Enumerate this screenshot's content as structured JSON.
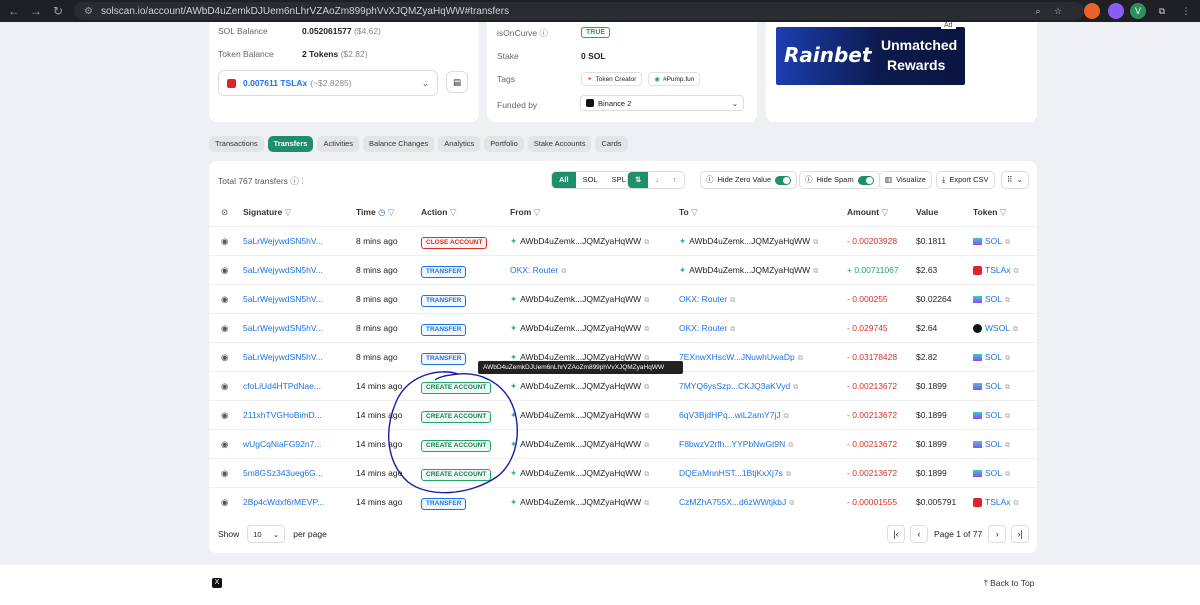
{
  "browser": {
    "url": "solscan.io/account/AWbD4uZemkDJUem6nLhrVZAoZm899phVvXJQMZyaHqWW#transfers",
    "back": "←",
    "forward": "→",
    "reload": "↻",
    "tune": "⚙"
  },
  "overview": {
    "sol_balance_label": "SOL Balance",
    "sol_balance_value": "0.052061577",
    "sol_balance_usd": "($4.62)",
    "token_balance_label": "Token Balance",
    "token_balance_value": "2 Tokens",
    "token_balance_usd": "($2.82)",
    "token_select_amount": "0.007611 TSLAx",
    "token_select_usd": "(~$2.8285)"
  },
  "more_info": {
    "is_on_curve_label": "isOnCurve",
    "is_on_curve_value": "TRUE",
    "stake_label": "Stake",
    "stake_value": "0 SOL",
    "tags_label": "Tags",
    "tags": [
      "Token Creator",
      "#Pump.fun"
    ],
    "funded_by_label": "Funded by",
    "funded_by_value": "Binance 2"
  },
  "ad": {
    "badge": "Ad",
    "brand": "Rainbet",
    "headline1": "Unmatched",
    "headline2": "Rewards",
    "colors": {
      "bg": "#0d1a4d",
      "accent": "#3b6bff"
    }
  },
  "tabs": [
    "Transactions",
    "Transfers",
    "Activities",
    "Balance Changes",
    "Analytics",
    "Portfolio",
    "Stake Accounts",
    "Cards"
  ],
  "active_tab": "Transfers",
  "toolbar": {
    "total_text": "Total 767 transfers",
    "filters": [
      "All",
      "SOL",
      "SPL"
    ],
    "hide_zero_label": "Hide Zero Value",
    "hide_spam_label": "Hide Spam",
    "visualize_label": "Visualize",
    "export_label": "Export CSV"
  },
  "columns": [
    "Signature",
    "Time",
    "Action",
    "From",
    "To",
    "Amount",
    "Value",
    "Token"
  ],
  "rows": [
    {
      "sig": "5aLrWejywdSN5hV...",
      "time": "8 mins ago",
      "action": "CLOSE ACCOUNT",
      "kind": "close",
      "from": "AWbD4uZemk...JQMZyaHqWW",
      "from_star": true,
      "to": "AWbD4uZemk...JQMZyaHqWW",
      "to_star": true,
      "amount": "- 0.00203928",
      "sign": "neg",
      "value": "$0.1811",
      "token": "SOL",
      "tok": "sol"
    },
    {
      "sig": "5aLrWejywdSN5hV...",
      "time": "8 mins ago",
      "action": "TRANSFER",
      "kind": "transfer",
      "from": "OKX: Router",
      "from_star": false,
      "to": "AWbD4uZemk...JQMZyaHqWW",
      "to_star": true,
      "amount": "+ 0.00711067",
      "sign": "pos",
      "value": "$2.63",
      "token": "TSLAx",
      "tok": "tsla"
    },
    {
      "sig": "5aLrWejywdSN5hV...",
      "time": "8 mins ago",
      "action": "TRANSFER",
      "kind": "transfer",
      "from": "AWbD4uZemk...JQMZyaHqWW",
      "from_star": true,
      "to": "OKX: Router",
      "to_star": false,
      "amount": "- 0.000255",
      "sign": "neg",
      "value": "$0.02264",
      "token": "SOL",
      "tok": "sol"
    },
    {
      "sig": "5aLrWejywdSN5hV...",
      "time": "8 mins ago",
      "action": "TRANSFER",
      "kind": "transfer",
      "from": "AWbD4uZemk...JQMZyaHqWW",
      "from_star": true,
      "to": "OKX: Router",
      "to_star": false,
      "amount": "- 0.029745",
      "sign": "neg",
      "value": "$2.64",
      "token": "WSOL",
      "tok": "wsol"
    },
    {
      "sig": "5aLrWejywdSN5hV...",
      "time": "8 mins ago",
      "action": "TRANSFER",
      "kind": "transfer",
      "from": "AWbD4uZemk...JQMZyaHqWW",
      "from_star": true,
      "to": "7EXnwXHscW...JNuwhUwaDp",
      "to_star": false,
      "amount": "- 0.03178428",
      "sign": "neg",
      "value": "$2.82",
      "token": "SOL",
      "tok": "sol"
    },
    {
      "sig": "cfoLiUd4HTPdNae...",
      "time": "14 mins ago",
      "action": "CREATE ACCOUNT",
      "kind": "create",
      "from": "AWbD4uZemk...JQMZyaHqWW",
      "from_star": true,
      "to": "7MYQ6ysSzp...CKJQ3aKVyd",
      "to_star": false,
      "amount": "- 0.00213672",
      "sign": "neg",
      "value": "$0.1899",
      "token": "SOL",
      "tok": "sol"
    },
    {
      "sig": "211xhTVGHoBimD...",
      "time": "14 mins ago",
      "action": "CREATE ACCOUNT",
      "kind": "create",
      "from": "AWbD4uZemk...JQMZyaHqWW",
      "from_star": true,
      "to": "6qV3BjdHPq...wiL2amY7jJ",
      "to_star": false,
      "amount": "- 0.00213672",
      "sign": "neg",
      "value": "$0.1899",
      "token": "SOL",
      "tok": "sol"
    },
    {
      "sig": "wUgCqNiaFG92n7...",
      "time": "14 mins ago",
      "action": "CREATE ACCOUNT",
      "kind": "create",
      "from": "AWbD4uZemk...JQMZyaHqWW",
      "from_star": true,
      "to": "F8bwzV2rfh...YYPbNwGt9N",
      "to_star": false,
      "amount": "- 0.00213672",
      "sign": "neg",
      "value": "$0.1899",
      "token": "SOL",
      "tok": "sol"
    },
    {
      "sig": "5m8GSz343ueg6G...",
      "time": "14 mins ago",
      "action": "CREATE ACCOUNT",
      "kind": "create",
      "from": "AWbD4uZemk...JQMZyaHqWW",
      "from_star": true,
      "to": "DQEaMnnHST...1BtjKxXj7s",
      "to_star": false,
      "amount": "- 0.00213672",
      "sign": "neg",
      "value": "$0.1899",
      "token": "SOL",
      "tok": "sol"
    },
    {
      "sig": "2Bp4cWdxf6rMEVP...",
      "time": "14 mins ago",
      "action": "TRANSFER",
      "kind": "transfer",
      "from": "AWbD4uZemk...JQMZyaHqWW",
      "from_star": true,
      "to": "CzMZhA755X...d6zWWtjkbJ",
      "to_star": false,
      "amount": "- 0.00001555",
      "sign": "neg",
      "value": "$0.005791",
      "token": "TSLAx",
      "tok": "tsla"
    }
  ],
  "tooltip": "AWbD4uZemkDJUem6nLhrVZAoZm899phVvXJQMZyaHqWW",
  "pagination": {
    "show_label": "Show",
    "page_size": "10",
    "per_page_label": "per page",
    "page_text": "Page 1 of 77"
  },
  "footer": {
    "back_to_top": "Back to Top"
  },
  "colors": {
    "primary": "#1f8f6b",
    "link": "#1a73e8",
    "negative": "#d93025",
    "positive": "#21a36b",
    "annotation": "#1a1aa8"
  }
}
